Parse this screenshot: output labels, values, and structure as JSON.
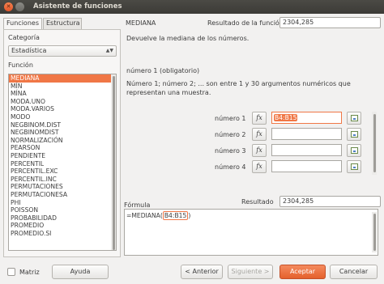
{
  "window": {
    "title": "Asistente de funciones"
  },
  "tabs": [
    {
      "label": "Funciones"
    },
    {
      "label": "Estructura"
    }
  ],
  "category": {
    "label": "Categoría",
    "value": "Estadística"
  },
  "function_list": {
    "label": "Función",
    "items": [
      "MEDIANA",
      "MÍN",
      "MÍNA",
      "MODA.UNO",
      "MODA.VARIOS",
      "MODO",
      "NEGBINOM.DIST",
      "NEGBINOMDIST",
      "NORMALIZACIÓN",
      "PEARSON",
      "PENDIENTE",
      "PERCENTIL",
      "PERCENTIL.EXC",
      "PERCENTIL.INC",
      "PERMUTACIONES",
      "PERMUTACIONESA",
      "PHI",
      "POISSON",
      "PROBABILIDAD",
      "PROMEDIO",
      "PROMEDIO.SI"
    ],
    "selected": "MEDIANA"
  },
  "function": {
    "name": "MEDIANA",
    "result_label": "Resultado de la función",
    "result_value": "2304,285",
    "description": "Devuelve la mediana de los números.",
    "arg_title": "número 1 (obligatorio)",
    "arg_description": "Número 1; número 2; ... son entre 1 y 30 argumentos numéricos que representan una muestra."
  },
  "arguments": [
    {
      "label": "número 1",
      "value": "B4:B15"
    },
    {
      "label": "número 2",
      "value": ""
    },
    {
      "label": "número 3",
      "value": ""
    },
    {
      "label": "número 4",
      "value": ""
    }
  ],
  "fx_symbol": "fx",
  "formula": {
    "label": "Fórmula",
    "result_label": "Resultado",
    "result_value": "2304,285",
    "prefix": "=MEDIANA(",
    "ref": "B4:B15",
    "suffix": ")"
  },
  "buttons": {
    "matrix": "Matriz",
    "help": "Ayuda",
    "back": "< Anterior",
    "next": "Siguiente >",
    "ok": "Aceptar",
    "cancel": "Cancelar"
  },
  "colors": {
    "accent": "#f07746",
    "titlebar": "#3c3b37"
  }
}
